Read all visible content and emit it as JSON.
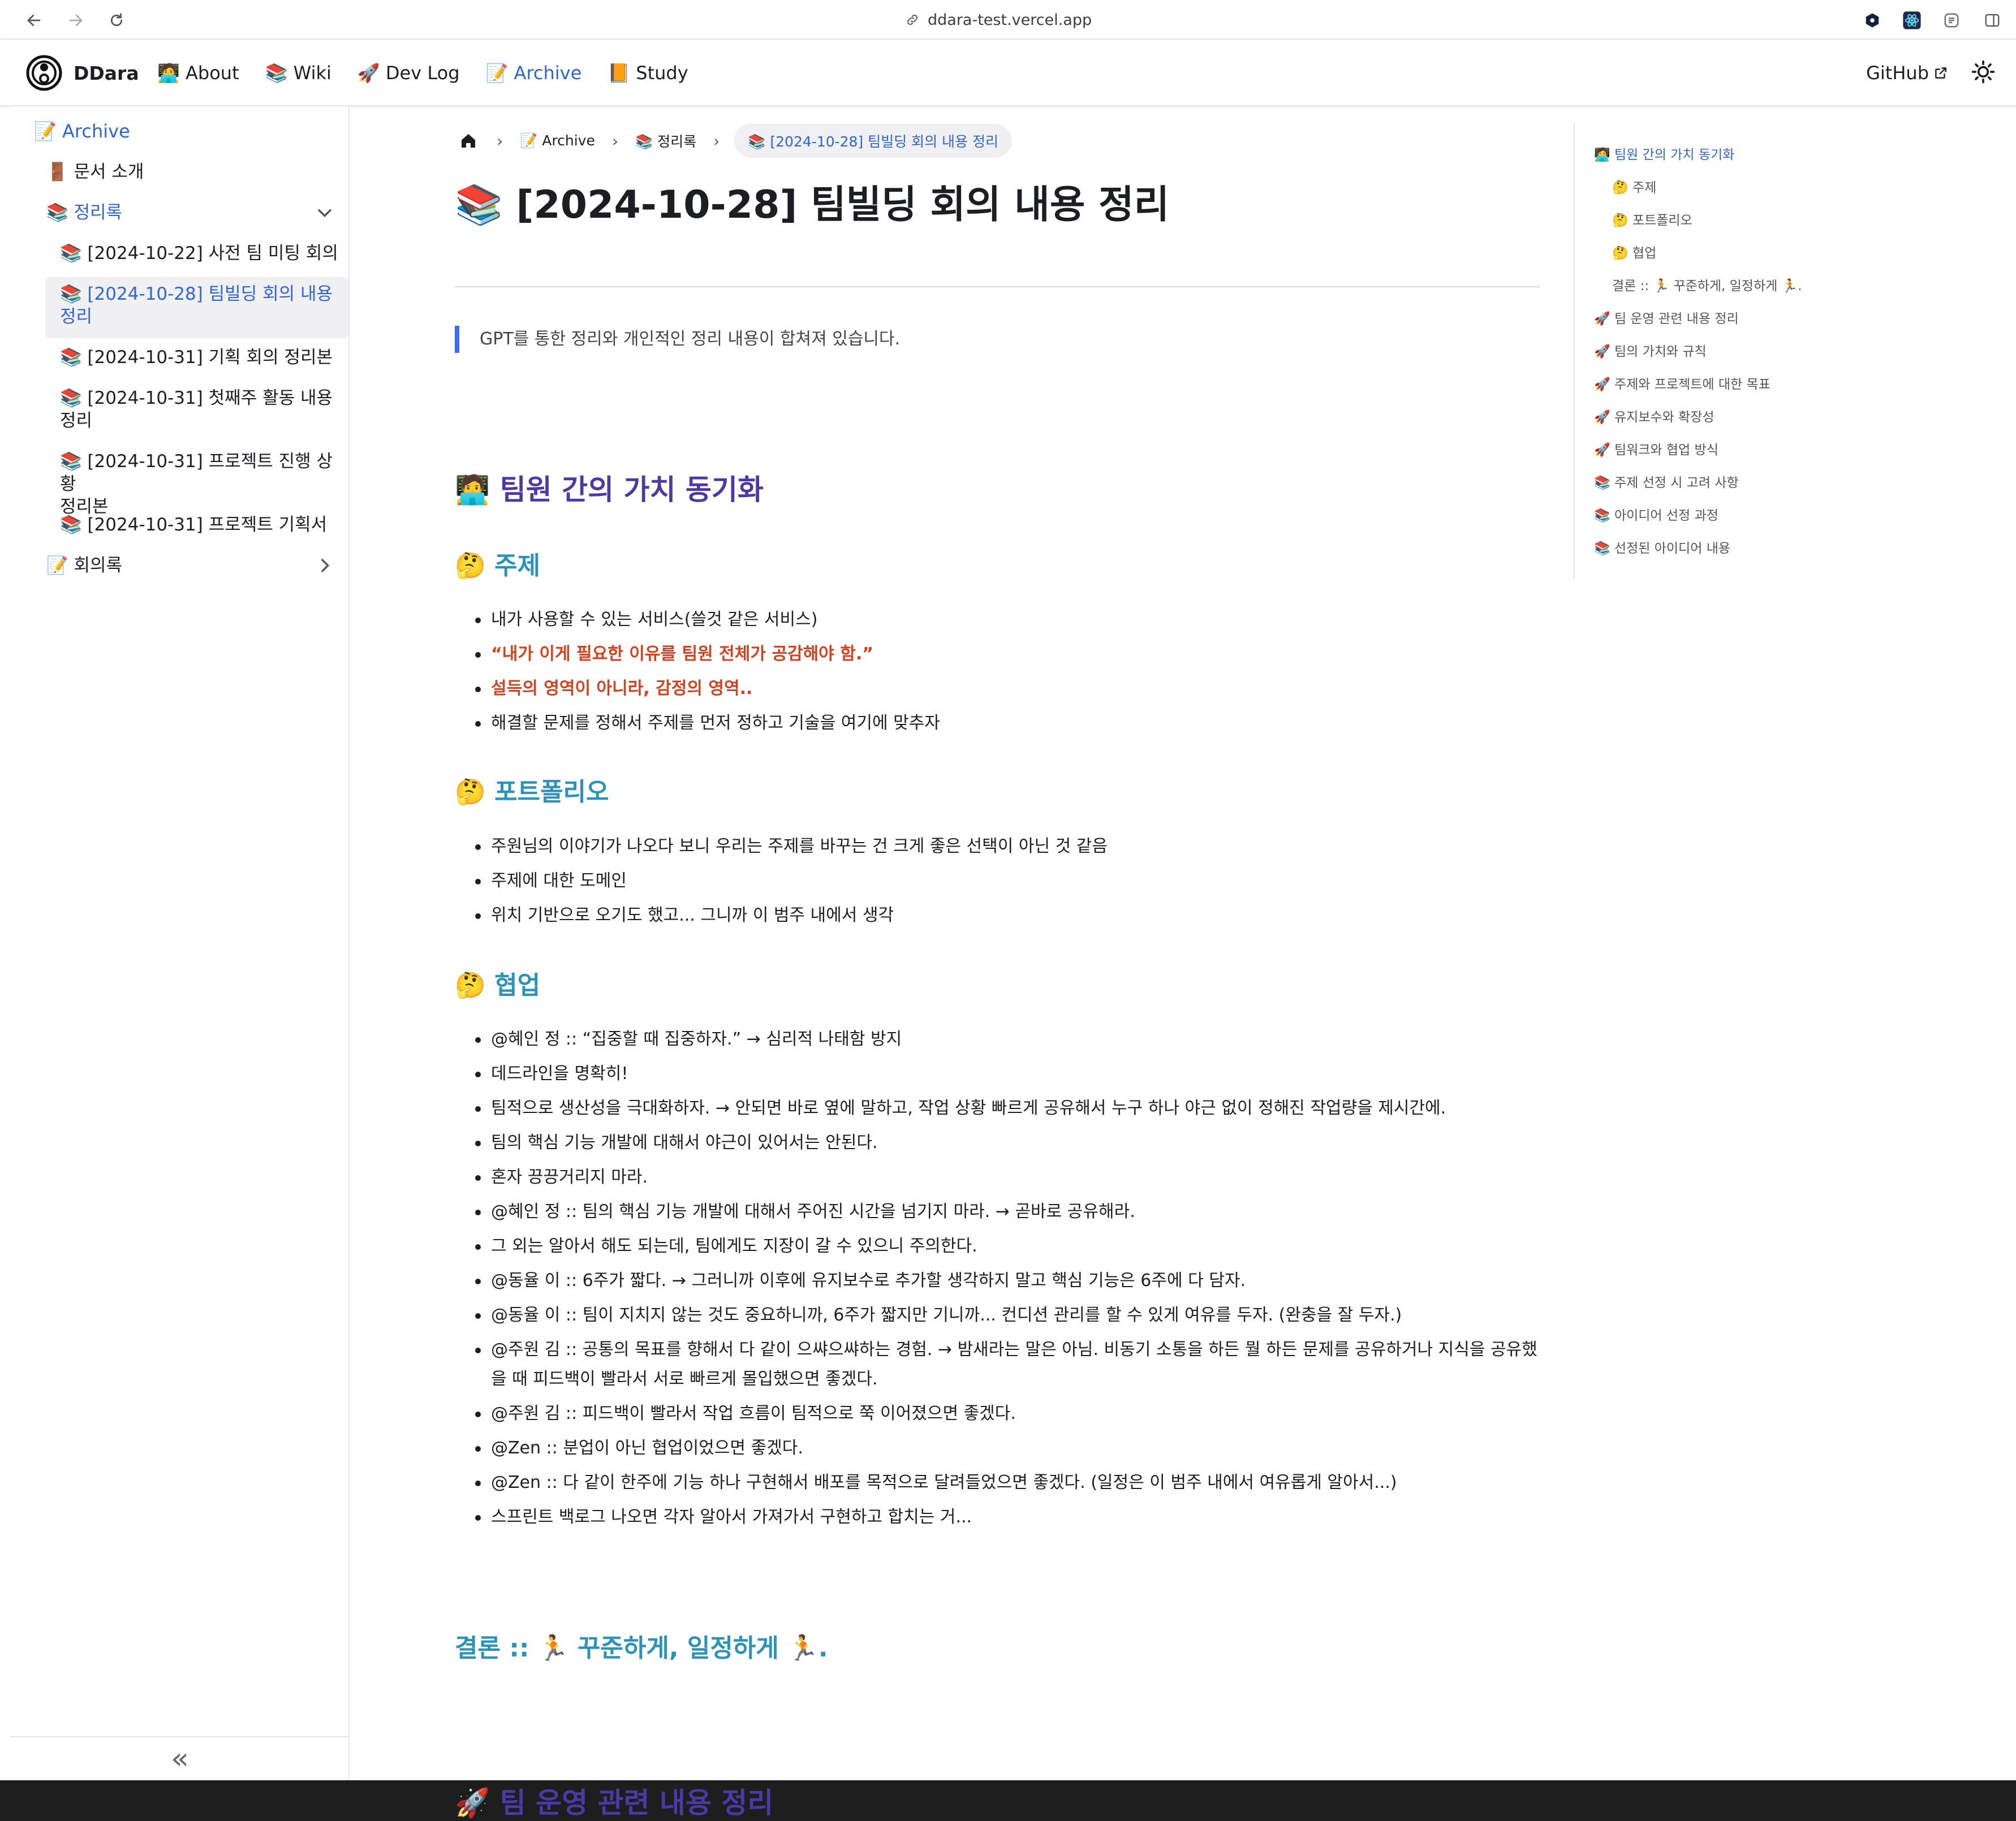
{
  "browser": {
    "url": "ddara-test.vercel.app"
  },
  "navbar": {
    "brand": "DDara",
    "items": [
      {
        "label": "🧑‍💻 About",
        "active": false
      },
      {
        "label": "📚 Wiki",
        "active": false
      },
      {
        "label": "🚀 Dev Log",
        "active": false
      },
      {
        "label": "📝 Archive",
        "active": true
      },
      {
        "label": "📙 Study",
        "active": false
      }
    ],
    "github": "GitHub"
  },
  "sidebar": {
    "root": "📝 Archive",
    "items": [
      {
        "label": "🚪 문서 소개"
      },
      {
        "label": "📚 정리록"
      },
      {
        "label": "📚 [2024-10-22] 사전 팀 미팅 회의"
      },
      {
        "label_line1": "📚 [2024-10-28] 팀빌딩 회의 내용",
        "label_line2": "정리"
      },
      {
        "label": "📚 [2024-10-31] 기획 회의 정리본"
      },
      {
        "label_line1": "📚 [2024-10-31] 첫째주 활동 내용",
        "label_line2": "정리"
      },
      {
        "label_line1": "📚 [2024-10-31] 프로젝트 진행 상황",
        "label_line2": "정리본"
      },
      {
        "label": "📚 [2024-10-31] 프로젝트 기획서"
      },
      {
        "label": "📝 회의록"
      }
    ],
    "collapse": "«"
  },
  "breadcrumb": {
    "items": [
      "📝 Archive",
      "📚 정리록"
    ],
    "current": "📚 [2024-10-28] 팀빌딩 회의 내용 정리"
  },
  "page": {
    "title": "📚 [2024-10-28] 팀빌딩 회의 내용 정리",
    "quote": "GPT를 통한 정리와 개인적인 정리 내용이 합쳐져 있습니다.",
    "h2_values": "🧑‍💻 팀원 간의 가치 동기화",
    "h3_topic": "🤔 주제",
    "topic_items": [
      "내가 사용할 수 있는 서비스(쓸것 같은 서비스)",
      "“내가 이게 필요한 이유를 팀원 전체가 공감해야 함.”",
      "설득의 영역이 아니라, 감정의 영역..",
      "해결할 문제를 정해서 주제를 먼저 정하고 기술을 여기에 맞추자"
    ],
    "h3_portfolio": "🤔 포트폴리오",
    "portfolio_items": [
      "주원님의 이야기가 나오다 보니 우리는 주제를 바꾸는 건 크게 좋은 선택이 아닌 것 같음",
      "주제에 대한 도메인",
      "위치 기반으로 오기도 했고... 그니까 이 범주 내에서 생각"
    ],
    "h3_collab": "🤔 협업",
    "collab_items": [
      "@혜인 정 :: “집중할 때 집중하자.” → 심리적 나태함 방지",
      "데드라인을 명확히!",
      "팀적으로 생산성을 극대화하자. → 안되면 바로 옆에 말하고, 작업 상황 빠르게 공유해서 누구 하나 야근 없이 정해진 작업량을 제시간에.",
      "팀의 핵심 기능 개발에 대해서 야근이 있어서는 안된다.",
      "혼자 끙끙거리지 마라.",
      "@혜인 정 :: 팀의 핵심 기능 개발에 대해서 주어진 시간을 넘기지 마라. → 곧바로 공유해라.",
      "그 외는 알아서 해도 되는데, 팀에게도 지장이 갈 수 있으니 주의한다.",
      "@동율 이 :: 6주가 짧다. → 그러니까 이후에 유지보수로 추가할 생각하지 말고 핵심 기능은 6주에 다 담자.",
      "@동율 이 :: 팀이 지치지 않는 것도 중요하니까, 6주가 짧지만 기니까... 컨디션 관리를 할 수 있게 여유를 두자. (완충을 잘 두자.)",
      "@주원 김 :: 공통의 목표를 향해서 다 같이 으쌰으쌰하는 경험. → 밤새라는 말은 아님. 비동기 소통을 하든 뭘 하든 문제를 공유하거나 지식을 공유했을 때 피드백이 빨라서 서로 빠르게 몰입했으면 좋겠다.",
      "@주원 김 :: 피드백이 빨라서 작업 흐름이 팀적으로 쭉 이어졌으면 좋겠다.",
      "@Zen :: 분업이 아닌 협업이었으면 좋겠다.",
      "@Zen :: 다 같이 한주에 기능 하나 구현해서 배포를 목적으로 달려들었으면 좋겠다. (일정은 이 범주 내에서 여유롭게 알아서...)",
      "스프린트 백로그 나오면 각자 알아서 가져가서 구현하고 합치는 거..."
    ],
    "h3_conclusion": "결론 :: 🏃 꾸준하게, 일정하게 🏃.",
    "h2_team": "🚀 팀 운영 관련 내용 정리"
  },
  "toc": {
    "items": [
      "🧑‍💻 팀원 간의 가치 동기화",
      "🤔 주제",
      "🤔 포트폴리오",
      "🤔 협업",
      "결론 :: 🏃 꾸준하게, 일정하게 🏃.",
      "🚀 팀 운영 관련 내용 정리",
      "🚀 팀의 가치와 규칙",
      "🚀 주제와 프로젝트에 대한 목표",
      "🚀 유지보수와 확장성",
      "🚀 팀워크와 협업 방식",
      "📚 주제 선정 시 고려 사항",
      "📚 아이디어 선정 과정",
      "📚 선정된 아이디어 내용"
    ]
  },
  "colors": {
    "link": "#2e64d4",
    "h2": "#4b3aa6",
    "h3": "#2c93b8",
    "emphasis": "#d6411b",
    "quote_bar": "#3a6ff0"
  }
}
